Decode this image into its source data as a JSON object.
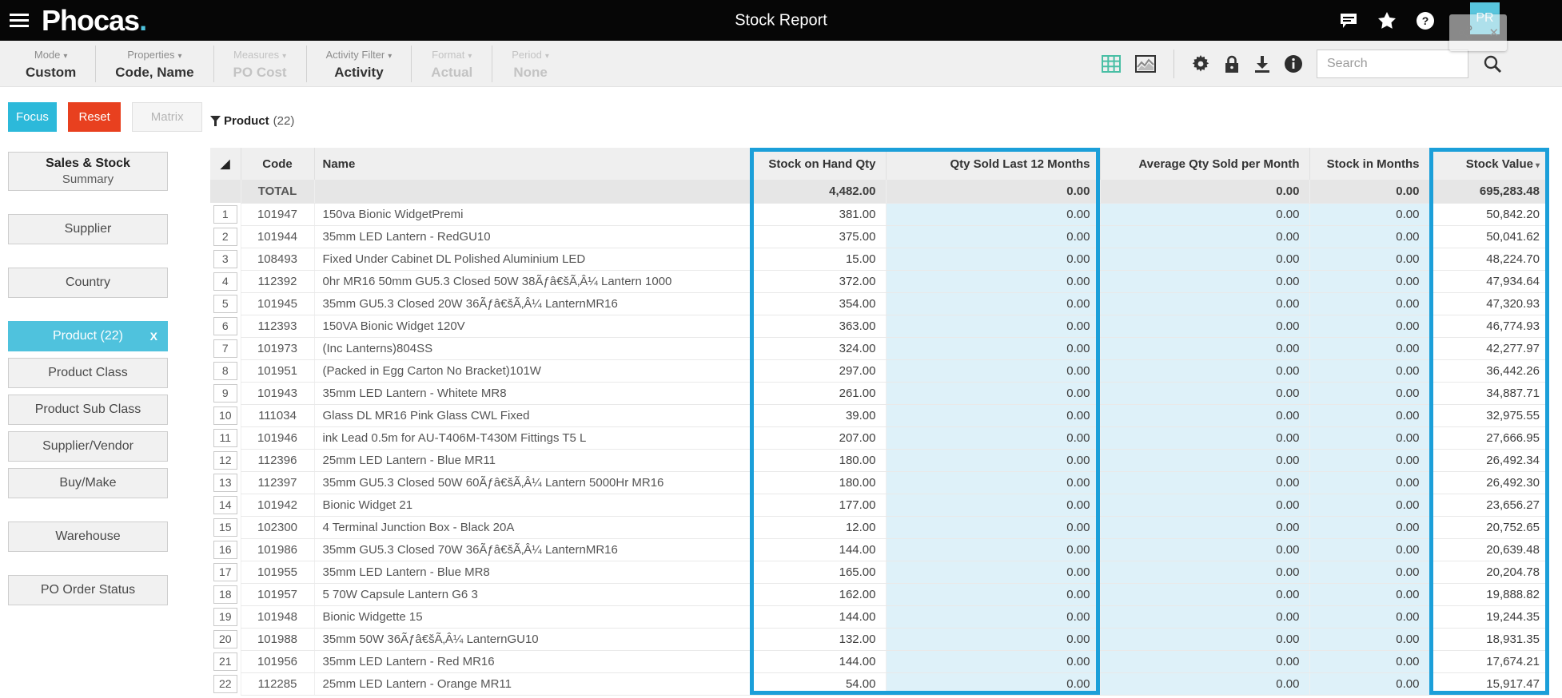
{
  "app": {
    "logo_text": "Phocas",
    "logo_dot": ".",
    "title": "Stock Report",
    "avatar": "PR"
  },
  "toolbar": {
    "groups": [
      {
        "label": "Mode",
        "value": "Custom",
        "enabled": true
      },
      {
        "label": "Properties",
        "value": "Code, Name",
        "enabled": true
      },
      {
        "label": "Measures",
        "value": "PO Cost",
        "enabled": false
      },
      {
        "label": "Activity Filter",
        "value": "Activity",
        "enabled": true
      },
      {
        "label": "Format",
        "value": "Actual",
        "enabled": false
      },
      {
        "label": "Period",
        "value": "None",
        "enabled": false
      }
    ],
    "caret": "▾",
    "search_placeholder": "Search"
  },
  "actions": {
    "focus": "Focus",
    "reset": "Reset",
    "matrix": "Matrix"
  },
  "sidebar": {
    "items": [
      {
        "label": "Sales & Stock",
        "sublabel": "Summary",
        "gap_after": true
      },
      {
        "label": "Supplier",
        "gap_after": true
      },
      {
        "label": "Country",
        "gap_after": true
      },
      {
        "label": "Product (22)",
        "active": true,
        "close": "X"
      },
      {
        "label": "Product Class"
      },
      {
        "label": "Product Sub Class"
      },
      {
        "label": "Supplier/Vendor"
      },
      {
        "label": "Buy/Make",
        "gap_after": true
      },
      {
        "label": "Warehouse",
        "gap_after": true
      },
      {
        "label": "PO Order Status"
      }
    ]
  },
  "filter": {
    "name": "Product",
    "count": "(22)"
  },
  "table": {
    "sort_corner": "◢",
    "columns": [
      "Code",
      "Name",
      "Stock on Hand Qty",
      "Qty Sold Last 12 Months",
      "Average Qty Sold per Month",
      "Stock in Months",
      "Stock Value"
    ],
    "sort_indicator": "▾",
    "total": {
      "label": "TOTAL",
      "soh": "4,482.00",
      "qty12": "0.00",
      "avg": "0.00",
      "months": "0.00",
      "value": "695,283.48"
    },
    "rows": [
      {
        "num": "1",
        "code": "101947",
        "name": "150va Bionic WidgetPremi",
        "soh": "381.00",
        "qty12": "0.00",
        "avg": "0.00",
        "months": "0.00",
        "value": "50,842.20"
      },
      {
        "num": "2",
        "code": "101944",
        "name": "35mm LED Lantern - RedGU10",
        "soh": "375.00",
        "qty12": "0.00",
        "avg": "0.00",
        "months": "0.00",
        "value": "50,041.62"
      },
      {
        "num": "3",
        "code": "108493",
        "name": "Fixed Under Cabinet DL Polished Aluminium LED",
        "soh": "15.00",
        "qty12": "0.00",
        "avg": "0.00",
        "months": "0.00",
        "value": "48,224.70"
      },
      {
        "num": "4",
        "code": "112392",
        "name": "0hr MR16 50mm GU5.3 Closed 50W 38Ãƒâ€šÃ‚Â¼ Lantern 1000",
        "soh": "372.00",
        "qty12": "0.00",
        "avg": "0.00",
        "months": "0.00",
        "value": "47,934.64"
      },
      {
        "num": "5",
        "code": "101945",
        "name": "35mm GU5.3 Closed 20W 36Ãƒâ€šÃ‚Â¼ LanternMR16",
        "soh": "354.00",
        "qty12": "0.00",
        "avg": "0.00",
        "months": "0.00",
        "value": "47,320.93"
      },
      {
        "num": "6",
        "code": "112393",
        "name": "150VA Bionic Widget 120V",
        "soh": "363.00",
        "qty12": "0.00",
        "avg": "0.00",
        "months": "0.00",
        "value": "46,774.93"
      },
      {
        "num": "7",
        "code": "101973",
        "name": "(Inc Lanterns)804SS",
        "soh": "324.00",
        "qty12": "0.00",
        "avg": "0.00",
        "months": "0.00",
        "value": "42,277.97"
      },
      {
        "num": "8",
        "code": "101951",
        "name": "(Packed in Egg Carton No Bracket)101W",
        "soh": "297.00",
        "qty12": "0.00",
        "avg": "0.00",
        "months": "0.00",
        "value": "36,442.26"
      },
      {
        "num": "9",
        "code": "101943",
        "name": "35mm LED Lantern - Whitete MR8",
        "soh": "261.00",
        "qty12": "0.00",
        "avg": "0.00",
        "months": "0.00",
        "value": "34,887.71"
      },
      {
        "num": "10",
        "code": "111034",
        "name": "Glass DL MR16 Pink Glass CWL Fixed",
        "soh": "39.00",
        "qty12": "0.00",
        "avg": "0.00",
        "months": "0.00",
        "value": "32,975.55"
      },
      {
        "num": "11",
        "code": "101946",
        "name": "ink Lead 0.5m for AU-T406M-T430M Fittings T5 L",
        "soh": "207.00",
        "qty12": "0.00",
        "avg": "0.00",
        "months": "0.00",
        "value": "27,666.95"
      },
      {
        "num": "12",
        "code": "112396",
        "name": "25mm LED Lantern - Blue MR11",
        "soh": "180.00",
        "qty12": "0.00",
        "avg": "0.00",
        "months": "0.00",
        "value": "26,492.34"
      },
      {
        "num": "13",
        "code": "112397",
        "name": "35mm GU5.3 Closed 50W 60Ãƒâ€šÃ‚Â¼ Lantern 5000Hr MR16",
        "soh": "180.00",
        "qty12": "0.00",
        "avg": "0.00",
        "months": "0.00",
        "value": "26,492.30"
      },
      {
        "num": "14",
        "code": "101942",
        "name": "Bionic Widget 21",
        "soh": "177.00",
        "qty12": "0.00",
        "avg": "0.00",
        "months": "0.00",
        "value": "23,656.27"
      },
      {
        "num": "15",
        "code": "102300",
        "name": "4 Terminal Junction Box - Black 20A",
        "soh": "12.00",
        "qty12": "0.00",
        "avg": "0.00",
        "months": "0.00",
        "value": "20,752.65"
      },
      {
        "num": "16",
        "code": "101986",
        "name": "35mm GU5.3 Closed 70W 36Ãƒâ€šÃ‚Â¼ LanternMR16",
        "soh": "144.00",
        "qty12": "0.00",
        "avg": "0.00",
        "months": "0.00",
        "value": "20,639.48"
      },
      {
        "num": "17",
        "code": "101955",
        "name": "35mm LED Lantern - Blue MR8",
        "soh": "165.00",
        "qty12": "0.00",
        "avg": "0.00",
        "months": "0.00",
        "value": "20,204.78"
      },
      {
        "num": "18",
        "code": "101957",
        "name": "5 70W Capsule Lantern G6 3",
        "soh": "162.00",
        "qty12": "0.00",
        "avg": "0.00",
        "months": "0.00",
        "value": "19,888.82"
      },
      {
        "num": "19",
        "code": "101948",
        "name": "Bionic Widgette 15",
        "soh": "144.00",
        "qty12": "0.00",
        "avg": "0.00",
        "months": "0.00",
        "value": "19,244.35"
      },
      {
        "num": "20",
        "code": "101988",
        "name": "35mm 50W 36Ãƒâ€šÃ‚Â¼ LanternGU10",
        "soh": "132.00",
        "qty12": "0.00",
        "avg": "0.00",
        "months": "0.00",
        "value": "18,931.35"
      },
      {
        "num": "21",
        "code": "101956",
        "name": "35mm LED Lantern - Red MR16",
        "soh": "144.00",
        "qty12": "0.00",
        "avg": "0.00",
        "months": "0.00",
        "value": "17,674.21"
      },
      {
        "num": "22",
        "code": "112285",
        "name": "25mm LED Lantern - Orange MR11",
        "soh": "54.00",
        "qty12": "0.00",
        "avg": "0.00",
        "months": "0.00",
        "value": "15,917.47"
      }
    ]
  },
  "colors": {
    "accent_teal": "#1b9fd9",
    "focus": "#2cb9da",
    "reset": "#e8401f",
    "active_item": "#4fc2dd",
    "tint": "#def1f9",
    "grid_icon": "#49bfa5"
  }
}
